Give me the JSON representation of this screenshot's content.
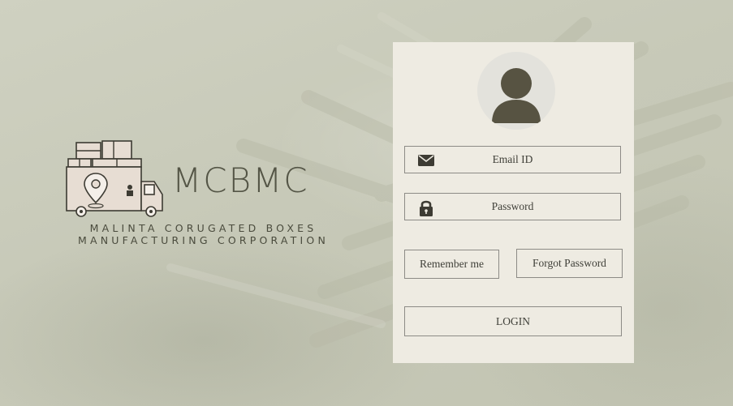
{
  "colors": {
    "background": "#c9cbba",
    "panel": "#eeebe2",
    "border": "#8d8b86",
    "icon_dark": "#3d3b33",
    "brand_text": "#545546"
  },
  "brand": {
    "name": "MCBMC",
    "subtitle_line1": "MALINTA CORUGATED BOXES",
    "subtitle_line2": "MANUFACTURING CORPORATION",
    "logo_icon": "delivery-truck-with-boxes-and-location-pin"
  },
  "login": {
    "avatar_icon": "user-icon",
    "email": {
      "label": "Email ID",
      "icon": "envelope-icon"
    },
    "password": {
      "label": "Password",
      "icon": "lock-icon"
    },
    "remember_label": "Remember me",
    "forgot_label": "Forgot Password",
    "login_label": "LOGIN"
  }
}
